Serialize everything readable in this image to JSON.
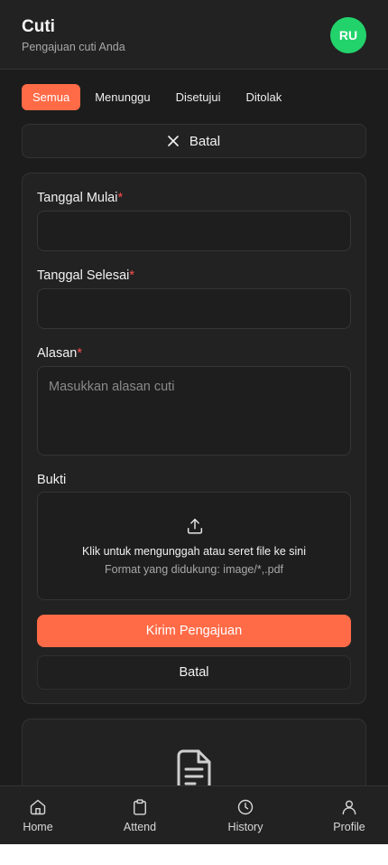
{
  "header": {
    "title": "Cuti",
    "subtitle": "Pengajuan cuti Anda",
    "avatar_initials": "RU",
    "avatar_color": "#22d36b"
  },
  "tabs": [
    {
      "label": "Semua",
      "active": true
    },
    {
      "label": "Menunggu",
      "active": false
    },
    {
      "label": "Disetujui",
      "active": false
    },
    {
      "label": "Ditolak",
      "active": false
    }
  ],
  "top_cancel": {
    "label": "Batal",
    "icon": "close-icon"
  },
  "form": {
    "start_date": {
      "label": "Tanggal Mulai",
      "required_mark": "*",
      "value": ""
    },
    "end_date": {
      "label": "Tanggal Selesai",
      "required_mark": "*",
      "value": ""
    },
    "reason": {
      "label": "Alasan",
      "required_mark": "*",
      "placeholder": "Masukkan alasan cuti",
      "value": ""
    },
    "proof": {
      "label": "Bukti",
      "icon": "upload-icon",
      "instruction": "Klik untuk mengunggah atau seret file ke sini",
      "formats": "Format yang didukung: image/*,.pdf"
    },
    "submit_label": "Kirim Pengajuan",
    "cancel_label": "Batal"
  },
  "empty_state": {
    "icon": "document-icon"
  },
  "bottom_nav": [
    {
      "label": "Home",
      "icon": "home-icon"
    },
    {
      "label": "Attend",
      "icon": "clipboard-icon"
    },
    {
      "label": "History",
      "icon": "clock-icon"
    },
    {
      "label": "Profile",
      "icon": "user-icon"
    }
  ],
  "colors": {
    "accent": "#ff6b47",
    "background": "#1c1c1c",
    "surface": "#222222",
    "required": "#ff4d4d"
  }
}
